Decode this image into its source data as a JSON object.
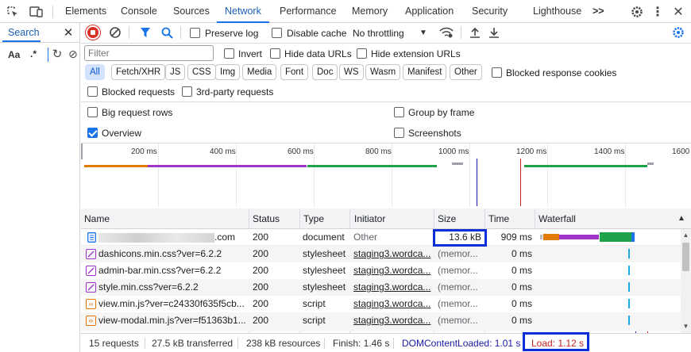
{
  "top_tabs": [
    "Elements",
    "Console",
    "Sources",
    "Network",
    "Performance",
    "Memory",
    "Application",
    "Security",
    "Lighthouse"
  ],
  "more_tabs": ">>",
  "left_pane": {
    "search_label": "Search",
    "aa": "Aa",
    "regex": ".*"
  },
  "toolbar": {
    "preserve_log": "Preserve log",
    "disable_cache": "Disable cache",
    "throttling": "No throttling"
  },
  "filter": {
    "placeholder": "Filter",
    "invert": "Invert",
    "hide_data_urls": "Hide data URLs",
    "hide_extension_urls": "Hide extension URLs"
  },
  "type_chips": [
    "All",
    "Fetch/XHR",
    "JS",
    "CSS",
    "Img",
    "Media",
    "Font",
    "Doc",
    "WS",
    "Wasm",
    "Manifest",
    "Other"
  ],
  "blocked_response_cookies": "Blocked response cookies",
  "blocked_requests": "Blocked requests",
  "third_party_requests": "3rd-party requests",
  "options": {
    "big_request_rows": "Big request rows",
    "group_by_frame": "Group by frame",
    "overview": "Overview",
    "screenshots": "Screenshots"
  },
  "overview_ticks": [
    "200 ms",
    "400 ms",
    "600 ms",
    "800 ms",
    "1000 ms",
    "1200 ms",
    "1400 ms",
    "1600"
  ],
  "columns": [
    "Name",
    "Status",
    "Type",
    "Initiator",
    "Size",
    "Time",
    "Waterfall"
  ],
  "rows": [
    {
      "name": ".com",
      "status": "200",
      "type": "document",
      "initiator": "Other",
      "size": "13.6 kB",
      "time": "909 ms"
    },
    {
      "name": "dashicons.min.css?ver=6.2.2",
      "status": "200",
      "type": "stylesheet",
      "initiator": "staging3.wordca...",
      "size": "(memor...",
      "time": "0 ms"
    },
    {
      "name": "admin-bar.min.css?ver=6.2.2",
      "status": "200",
      "type": "stylesheet",
      "initiator": "staging3.wordca...",
      "size": "(memor...",
      "time": "0 ms"
    },
    {
      "name": "style.min.css?ver=6.2.2",
      "status": "200",
      "type": "stylesheet",
      "initiator": "staging3.wordca...",
      "size": "(memor...",
      "time": "0 ms"
    },
    {
      "name": "view.min.js?ver=c24330f635f5cb...",
      "status": "200",
      "type": "script",
      "initiator": "staging3.wordca...",
      "size": "(memor...",
      "time": "0 ms"
    },
    {
      "name": "view-modal.min.js?ver=f51363b1...",
      "status": "200",
      "type": "script",
      "initiator": "staging3.wordca...",
      "size": "(memor...",
      "time": "0 ms"
    }
  ],
  "status_bar": {
    "requests": "15 requests",
    "transferred": "27.5 kB transferred",
    "resources": "238 kB resources",
    "finish": "Finish: 1.46 s",
    "dom_content_loaded": "DOMContentLoaded: 1.01 s",
    "load": "Load: 1.12 s"
  },
  "colors": {
    "accent": "#1a73e8",
    "dcl": "#1a1aa6",
    "load": "#c5221f",
    "highlight": "#0a2fd6"
  }
}
